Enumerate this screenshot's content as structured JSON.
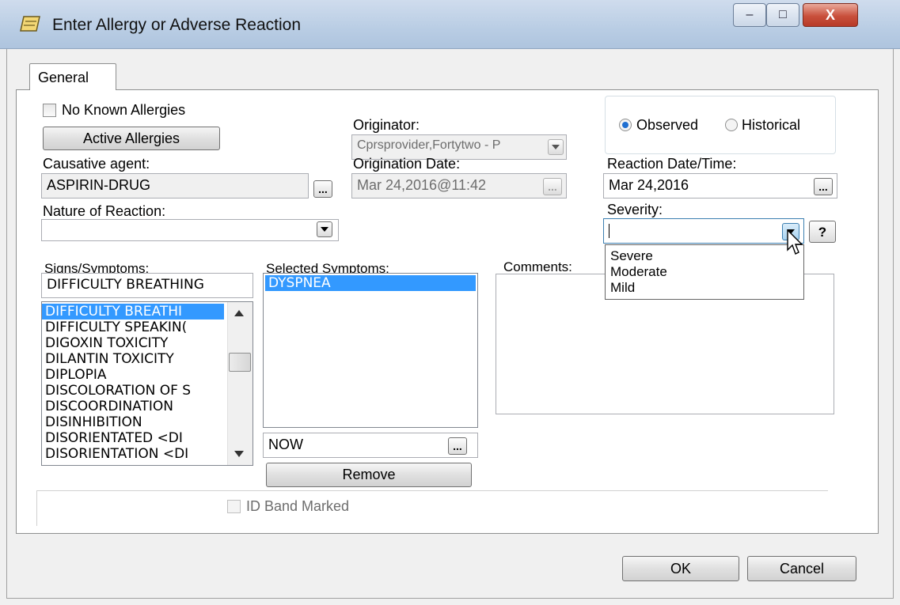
{
  "window": {
    "title": "Enter Allergy or Adverse Reaction",
    "minimize_label": "–",
    "maximize_label": "□",
    "close_label": "X"
  },
  "tabs": [
    "General"
  ],
  "general": {
    "no_known_allergies": {
      "label": "No Known Allergies",
      "checked": false
    },
    "active_allergies_button": "Active Allergies",
    "causative_agent": {
      "label": "Causative agent:",
      "value": "ASPIRIN-DRUG",
      "browse_label": "..."
    },
    "nature_of_reaction": {
      "label": "Nature of Reaction:",
      "value": ""
    },
    "originator": {
      "label": "Originator:",
      "value": "Cprsprovider,Fortytwo - P"
    },
    "origination_date": {
      "label": "Origination Date:",
      "value": "Mar 24,2016@11:42",
      "browse_label": "..."
    },
    "observation": {
      "options": [
        "Observed",
        "Historical"
      ],
      "selected": "Observed"
    },
    "reaction_datetime": {
      "label": "Reaction Date/Time:",
      "value": "Mar 24,2016",
      "browse_label": "..."
    },
    "severity": {
      "label": "Severity:",
      "value": "",
      "help_label": "?",
      "options": [
        "Severe",
        "Moderate",
        "Mild"
      ]
    },
    "signs_symptoms": {
      "label": "Signs/Symptoms:",
      "search_value": "DIFFICULTY BREATHING",
      "items": [
        "DIFFICULTY BREATHI",
        "DIFFICULTY SPEAKIN(",
        "DIGOXIN TOXICITY",
        "DILANTIN TOXICITY",
        "DIPLOPIA",
        "DISCOLORATION OF S",
        "DISCOORDINATION",
        "DISINHIBITION",
        "DISORIENTATED  <DI",
        "DISORIENTATION <DI"
      ],
      "selected_index": 0
    },
    "selected_symptoms": {
      "label": "Selected Symptoms:",
      "items": [
        "DYSPNEA"
      ],
      "date_value": "NOW",
      "browse_label": "...",
      "remove_button": "Remove"
    },
    "comments": {
      "label": "Comments:",
      "value": ""
    },
    "id_band": {
      "label": "ID Band Marked",
      "checked": false,
      "enabled": false
    }
  },
  "footer": {
    "ok_label": "OK",
    "cancel_label": "Cancel"
  }
}
